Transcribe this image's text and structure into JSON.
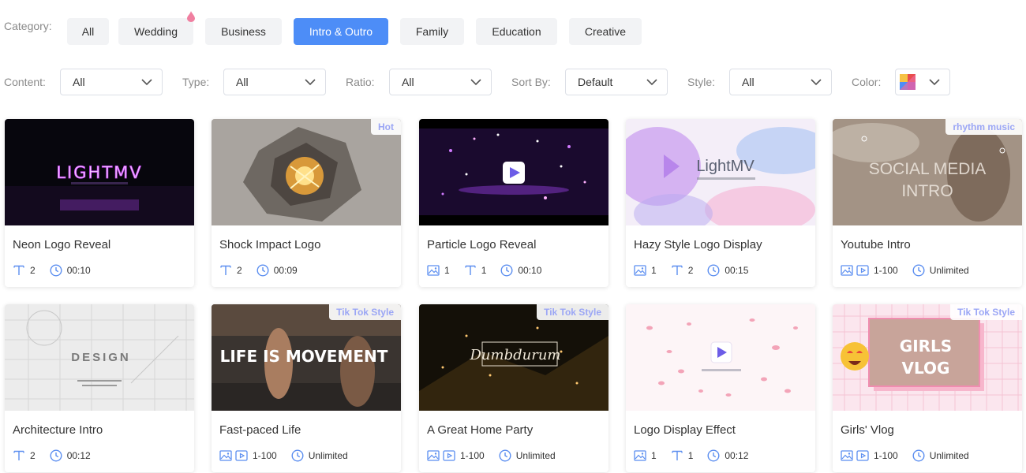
{
  "filters": {
    "category_label": "Category:",
    "categories": [
      {
        "label": "All",
        "active": false
      },
      {
        "label": "Wedding",
        "active": false,
        "hot": true
      },
      {
        "label": "Business",
        "active": false
      },
      {
        "label": "Intro & Outro",
        "active": true
      },
      {
        "label": "Family",
        "active": false
      },
      {
        "label": "Education",
        "active": false
      },
      {
        "label": "Creative",
        "active": false
      }
    ],
    "content_label": "Content:",
    "content_value": "All",
    "type_label": "Type:",
    "type_value": "All",
    "ratio_label": "Ratio:",
    "ratio_value": "All",
    "sort_label": "Sort By:",
    "sort_value": "Default",
    "style_label": "Style:",
    "style_value": "All",
    "color_label": "Color:"
  },
  "colors": {
    "accent": "#4d8df7",
    "pill_bg": "#f2f3f5",
    "icon_blue": "#5b8ef0",
    "tag_text": "#9ba6f5",
    "hot_drop": "#f07fa0"
  },
  "templates": [
    {
      "title": "Neon Logo Reveal",
      "tag": "",
      "thumb_text": "LIGHTMV",
      "meta": [
        {
          "icon": "text-icon",
          "value": "2"
        },
        {
          "icon": "clock-icon",
          "value": "00:10"
        }
      ]
    },
    {
      "title": "Shock Impact Logo",
      "tag": "Hot",
      "thumb_text": "",
      "meta": [
        {
          "icon": "text-icon",
          "value": "2"
        },
        {
          "icon": "clock-icon",
          "value": "00:09"
        }
      ]
    },
    {
      "title": "Particle Logo Reveal",
      "tag": "",
      "thumb_text": "",
      "meta": [
        {
          "icon": "image-icon",
          "value": "1"
        },
        {
          "icon": "text-icon",
          "value": "1"
        },
        {
          "icon": "clock-icon",
          "value": "00:10"
        }
      ]
    },
    {
      "title": "Hazy Style Logo Display",
      "tag": "",
      "thumb_text": "LightMV",
      "meta": [
        {
          "icon": "image-icon",
          "value": "1"
        },
        {
          "icon": "text-icon",
          "value": "2"
        },
        {
          "icon": "clock-icon",
          "value": "00:15"
        }
      ]
    },
    {
      "title": "Youtube Intro",
      "tag": "rhythm music",
      "thumb_text": "SOCIAL MEDIA INTRO",
      "meta": [
        {
          "icon": "image-video-icon",
          "value": "1-100"
        },
        {
          "icon": "clock-icon",
          "value": "Unlimited"
        }
      ]
    },
    {
      "title": "Architecture Intro",
      "tag": "",
      "thumb_text": "DESIGN",
      "meta": [
        {
          "icon": "text-icon",
          "value": "2"
        },
        {
          "icon": "clock-icon",
          "value": "00:12"
        }
      ]
    },
    {
      "title": "Fast-paced Life",
      "tag": "Tik Tok Style",
      "thumb_text": "LIFE IS MOVEMENT",
      "meta": [
        {
          "icon": "image-video-icon",
          "value": "1-100"
        },
        {
          "icon": "clock-icon",
          "value": "Unlimited"
        }
      ]
    },
    {
      "title": "A Great Home Party",
      "tag": "Tik Tok Style",
      "thumb_text": "Dumbdurum",
      "meta": [
        {
          "icon": "image-video-icon",
          "value": "1-100"
        },
        {
          "icon": "clock-icon",
          "value": "Unlimited"
        }
      ]
    },
    {
      "title": "Logo Display Effect",
      "tag": "",
      "thumb_text": "",
      "meta": [
        {
          "icon": "image-icon",
          "value": "1"
        },
        {
          "icon": "text-icon",
          "value": "1"
        },
        {
          "icon": "clock-icon",
          "value": "00:12"
        }
      ]
    },
    {
      "title": "Girls' Vlog",
      "tag": "Tik Tok Style",
      "thumb_text": "GIRLS VLOG",
      "meta": [
        {
          "icon": "image-video-icon",
          "value": "1-100"
        },
        {
          "icon": "clock-icon",
          "value": "Unlimited"
        }
      ]
    }
  ]
}
